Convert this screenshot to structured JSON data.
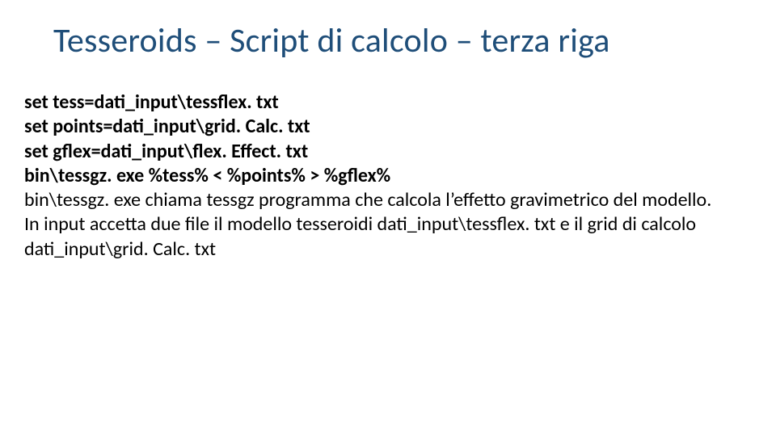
{
  "slide": {
    "title": "Tesseroids – Script di calcolo – terza riga",
    "lines": {
      "l1": "set tess=dati_input\\tessflex. txt",
      "l2": "set points=dati_input\\grid. Calc. txt",
      "l3": "set gflex=dati_input\\flex. Effect. txt",
      "l4": "bin\\tessgz. exe %tess% < %points% > %gflex%",
      "l5": "bin\\tessgz. exe chiama tessgz programma che calcola l’effetto gravimetrico del modello.",
      "l6": "In input accetta due file il modello tesseroidi dati_input\\tessflex. txt e il grid di calcolo dati_input\\grid. Calc. txt"
    }
  }
}
